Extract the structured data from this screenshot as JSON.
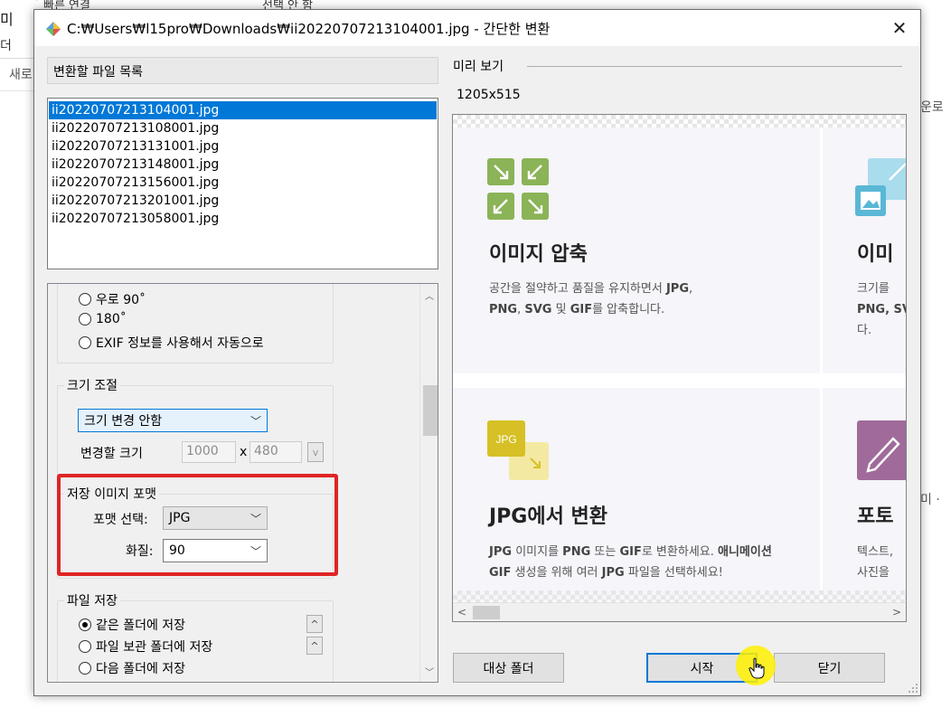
{
  "background": {
    "tab_fragment_1": "빠른 연결",
    "tab_fragment_2": "선택 안 함",
    "left_fragment_1": "미",
    "left_fragment_2": "더",
    "left_fragment_3": "새로",
    "right_fragment_1": "운로",
    "right_fragment_2": "미 ·"
  },
  "dialog": {
    "title": "C:₩Users₩l15pro₩Downloads₩ii20220707213104001.jpg - 간단한 변환",
    "close_glyph": "✕"
  },
  "file_list": {
    "header": "변환할 파일 목록",
    "files": [
      "ii20220707213104001.jpg",
      "ii20220707213108001.jpg",
      "ii20220707213131001.jpg",
      "ii20220707213148001.jpg",
      "ii20220707213156001.jpg",
      "ii20220707213201001.jpg",
      "ii20220707213058001.jpg"
    ],
    "selected_index": 0
  },
  "rotation": {
    "options": [
      "우로 90˚",
      "180˚",
      "EXIF 정보를 사용해서 자동으로"
    ]
  },
  "resize": {
    "group_title": "크기 조절",
    "mode_value": "크기 변경 안함",
    "size_label": "변경할 크기",
    "width_value": "1000",
    "times": "x",
    "height_value": "480",
    "unit_button": "v"
  },
  "format": {
    "group_title": "저장 이미지 포맷",
    "format_label": "포맷 선택:",
    "format_value": "JPG",
    "quality_label": "화질:",
    "quality_value": "90",
    "highlight_color": "#e02424"
  },
  "save": {
    "group_title": "파일 저장",
    "options": [
      "같은 폴더에 저장",
      "파일 보관 폴더에 저장",
      "다음 폴더에 저장"
    ],
    "selected_index": 0,
    "up_glyph": "^"
  },
  "preview": {
    "label": "미리 보기",
    "image_size": "1205x515",
    "cards": {
      "compress_title": "이미지 압축",
      "compress_desc_1": "공간을 절약하고 품질을 유지하면서",
      "compress_desc_bold_1": "JPG",
      "compress_desc_bold_2": "PNG",
      "compress_desc_bold_3": "SVG",
      "compress_desc_2": "및",
      "compress_desc_bold_4": "GIF",
      "compress_desc_3": "를 압축합니다.",
      "resize_title_fragment": "이미",
      "resize_desc_1": "크기를",
      "resize_desc_2": "PNG, SV",
      "resize_desc_3": "다.",
      "jpg_title": "JPG에서 변환",
      "jpg_badge": "JPG",
      "jpg_desc_1": "JPG",
      "jpg_desc_2": "이미지를",
      "jpg_desc_3": "PNG",
      "jpg_desc_4": "또는",
      "jpg_desc_5": "GIF",
      "jpg_desc_6": "로 변환하세요.",
      "jpg_desc_7": "애니메이션 GIF",
      "jpg_desc_8": "생성을 위해 여러",
      "jpg_desc_9": "JPG",
      "jpg_desc_10": "파일을 선택하세요!",
      "photo_title_fragment": "포토",
      "photo_desc_1": "텍스트,",
      "photo_desc_2": "사진을"
    },
    "colors": {
      "compress_icon": "#8bb357",
      "resize_icon": "#5ab7d6",
      "jpg_icon": "#d6c025",
      "photo_icon": "#a06b9a"
    }
  },
  "buttons": {
    "target_folder": "대상 폴더",
    "start": "시작",
    "close": "닫기"
  }
}
